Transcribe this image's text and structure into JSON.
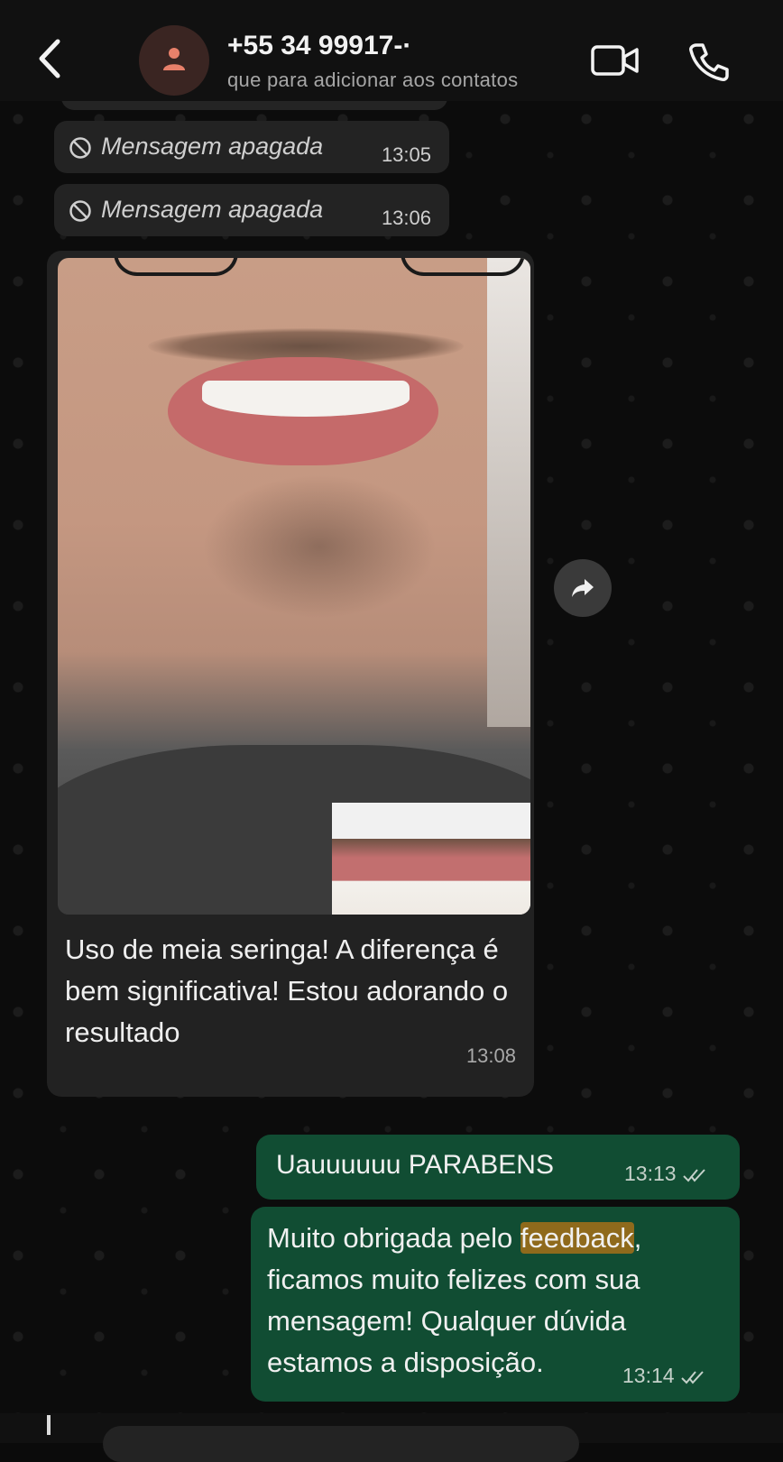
{
  "header": {
    "contact_name": "+55 34 99917-·",
    "subtitle": "que para adicionar aos contatos",
    "icons": [
      "back-icon",
      "person-icon",
      "video-call-icon",
      "voice-call-icon"
    ]
  },
  "chat": {
    "deleted_messages": [
      {
        "text": "Mensagem apagada",
        "time": "13:05"
      },
      {
        "text": "Mensagem apagada",
        "time": "13:06"
      }
    ],
    "image_message": {
      "caption": "Uso de meia seringa! A diferença é bem significativa! Estou adorando o resultado",
      "time": "13:08"
    },
    "outgoing": [
      {
        "text": "Uauuuuuu PARABENS",
        "time": "13:13"
      },
      {
        "text_before": "Muito obrigada pelo ",
        "highlight": "feedback",
        "text_after": ", ficamos muito felizes com sua mensagem! Qualquer dúvida estamos a disposição.",
        "time": "13:14"
      }
    ]
  },
  "colors": {
    "outgoing_bubble": "#114d33",
    "incoming_bubble": "#232323",
    "highlight": "#8f6a1c",
    "avatar_icon": "#e8806a"
  }
}
